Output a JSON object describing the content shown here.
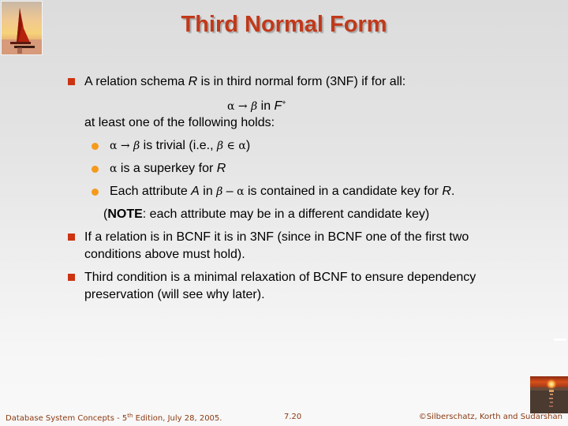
{
  "slide": {
    "title": "Third Normal Form",
    "bullets": [
      {
        "prefix": "A relation schema ",
        "var": "R",
        "suffix": " is in third normal form (3NF) if for all:",
        "formula": {
          "lhs": "α",
          "arrow": "→",
          "rhs": "β",
          "text": " in ",
          "set": "F",
          "sup": "+"
        },
        "continuation": "at least one of the following holds:",
        "subitems": [
          {
            "a": "α",
            "arrow": "→",
            "b": "β",
            "text": " is trivial (i.e., ",
            "b2": "β",
            "elem": "∈",
            "a2": "α",
            "close": ")"
          },
          {
            "a": "α",
            "text": " is a superkey for ",
            "var": "R"
          },
          {
            "text1": "Each attribute ",
            "var": "A",
            "text2": " in ",
            "b": "β",
            "minus": " – ",
            "a": "α",
            "text3": " is contained in a candidate key for ",
            "var2": "R",
            "end": "."
          }
        ],
        "note": {
          "open": "(",
          "bold": "NOTE",
          "rest": ": each attribute may be in a different candidate key)"
        }
      },
      {
        "line1": "If a relation is in BCNF it is in 3NF (since in BCNF one of the first two",
        "line2": "conditions above must hold)."
      },
      {
        "line1": "Third condition is a minimal relaxation of BCNF to ensure dependency",
        "line2": "preservation (will see why later)."
      }
    ]
  },
  "footer": {
    "left_prefix": "Database System Concepts - 5",
    "left_sup": "th",
    "left_suffix": " Edition, July 28, 2005.",
    "page": "7.20",
    "copyright": "©Silberschatz, Korth and Sudarshan"
  },
  "colors": {
    "title": "#c0391a",
    "square_bullet": "#cc3311",
    "dot_bullet": "#f59a1c",
    "footer_text": "#8a3a12"
  }
}
